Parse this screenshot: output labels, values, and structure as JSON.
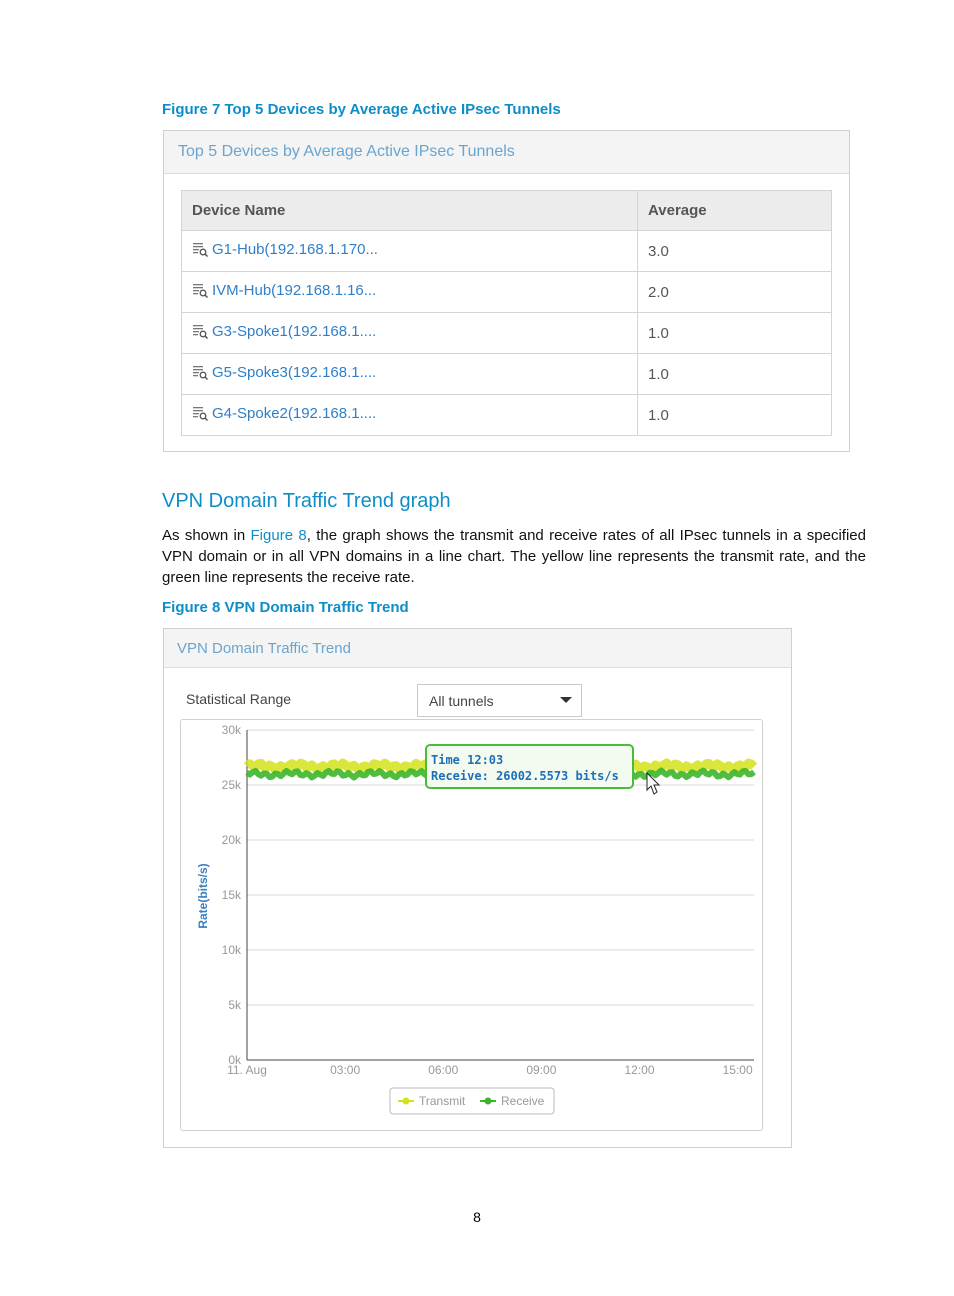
{
  "figure7": {
    "caption": "Figure 7 Top 5 Devices by Average Active IPsec Tunnels",
    "panel_title": "Top 5 Devices by Average Active IPsec Tunnels",
    "columns": [
      "Device Name",
      "Average"
    ],
    "rows": [
      {
        "device": "G1-Hub(192.168.1.170...",
        "average": "3.0"
      },
      {
        "device": "IVM-Hub(192.168.1.16...",
        "average": "2.0"
      },
      {
        "device": "G3-Spoke1(192.168.1....",
        "average": "1.0"
      },
      {
        "device": "G5-Spoke3(192.168.1....",
        "average": "1.0"
      },
      {
        "device": "G4-Spoke2(192.168.1....",
        "average": "1.0"
      }
    ],
    "row_icon": "device-detail-icon"
  },
  "section": {
    "title": "VPN Domain Traffic Trend graph",
    "para_before_link": "As shown in ",
    "para_link": "Figure 8",
    "para_after_link": ", the graph shows the transmit and receive rates of all IPsec tunnels in a specified VPN domain or in all VPN domains in a line chart. The yellow line represents the transmit rate, and the green line represents the receive rate."
  },
  "figure8": {
    "caption": "Figure 8 VPN Domain Traffic Trend",
    "panel_title": "VPN Domain Traffic Trend",
    "range_label": "Statistical Range",
    "range_value": "All tunnels",
    "tooltip_time": "Time 12:03",
    "tooltip_receive": "Receive: 26002.5573 bits/s"
  },
  "chart_data": {
    "type": "line",
    "title": "",
    "xlabel": "",
    "ylabel": "Rate(bits/s)",
    "x_ticks": [
      "11. Aug",
      "03:00",
      "06:00",
      "09:00",
      "12:00",
      "15:00"
    ],
    "x_range_hours": [
      0,
      15.5
    ],
    "y_ticks": [
      "0k",
      "5k",
      "10k",
      "15k",
      "20k",
      "25k",
      "30k"
    ],
    "ylim": [
      0,
      30000
    ],
    "grid": true,
    "legend_position": "bottom-center",
    "series": [
      {
        "name": "Transmit",
        "color": "#d4e21a",
        "level": 26700,
        "x": [
          0,
          15.5
        ]
      },
      {
        "name": "Receive",
        "color": "#3db52b",
        "level": 26000,
        "x": [
          0,
          15.5
        ]
      }
    ]
  },
  "page_number": "8",
  "colors": {
    "accent": "#0e8ec9",
    "link": "#2f7fc8",
    "transmit": "#d4e21a",
    "receive": "#3db52b",
    "tooltip_border": "#4cbb3c"
  }
}
